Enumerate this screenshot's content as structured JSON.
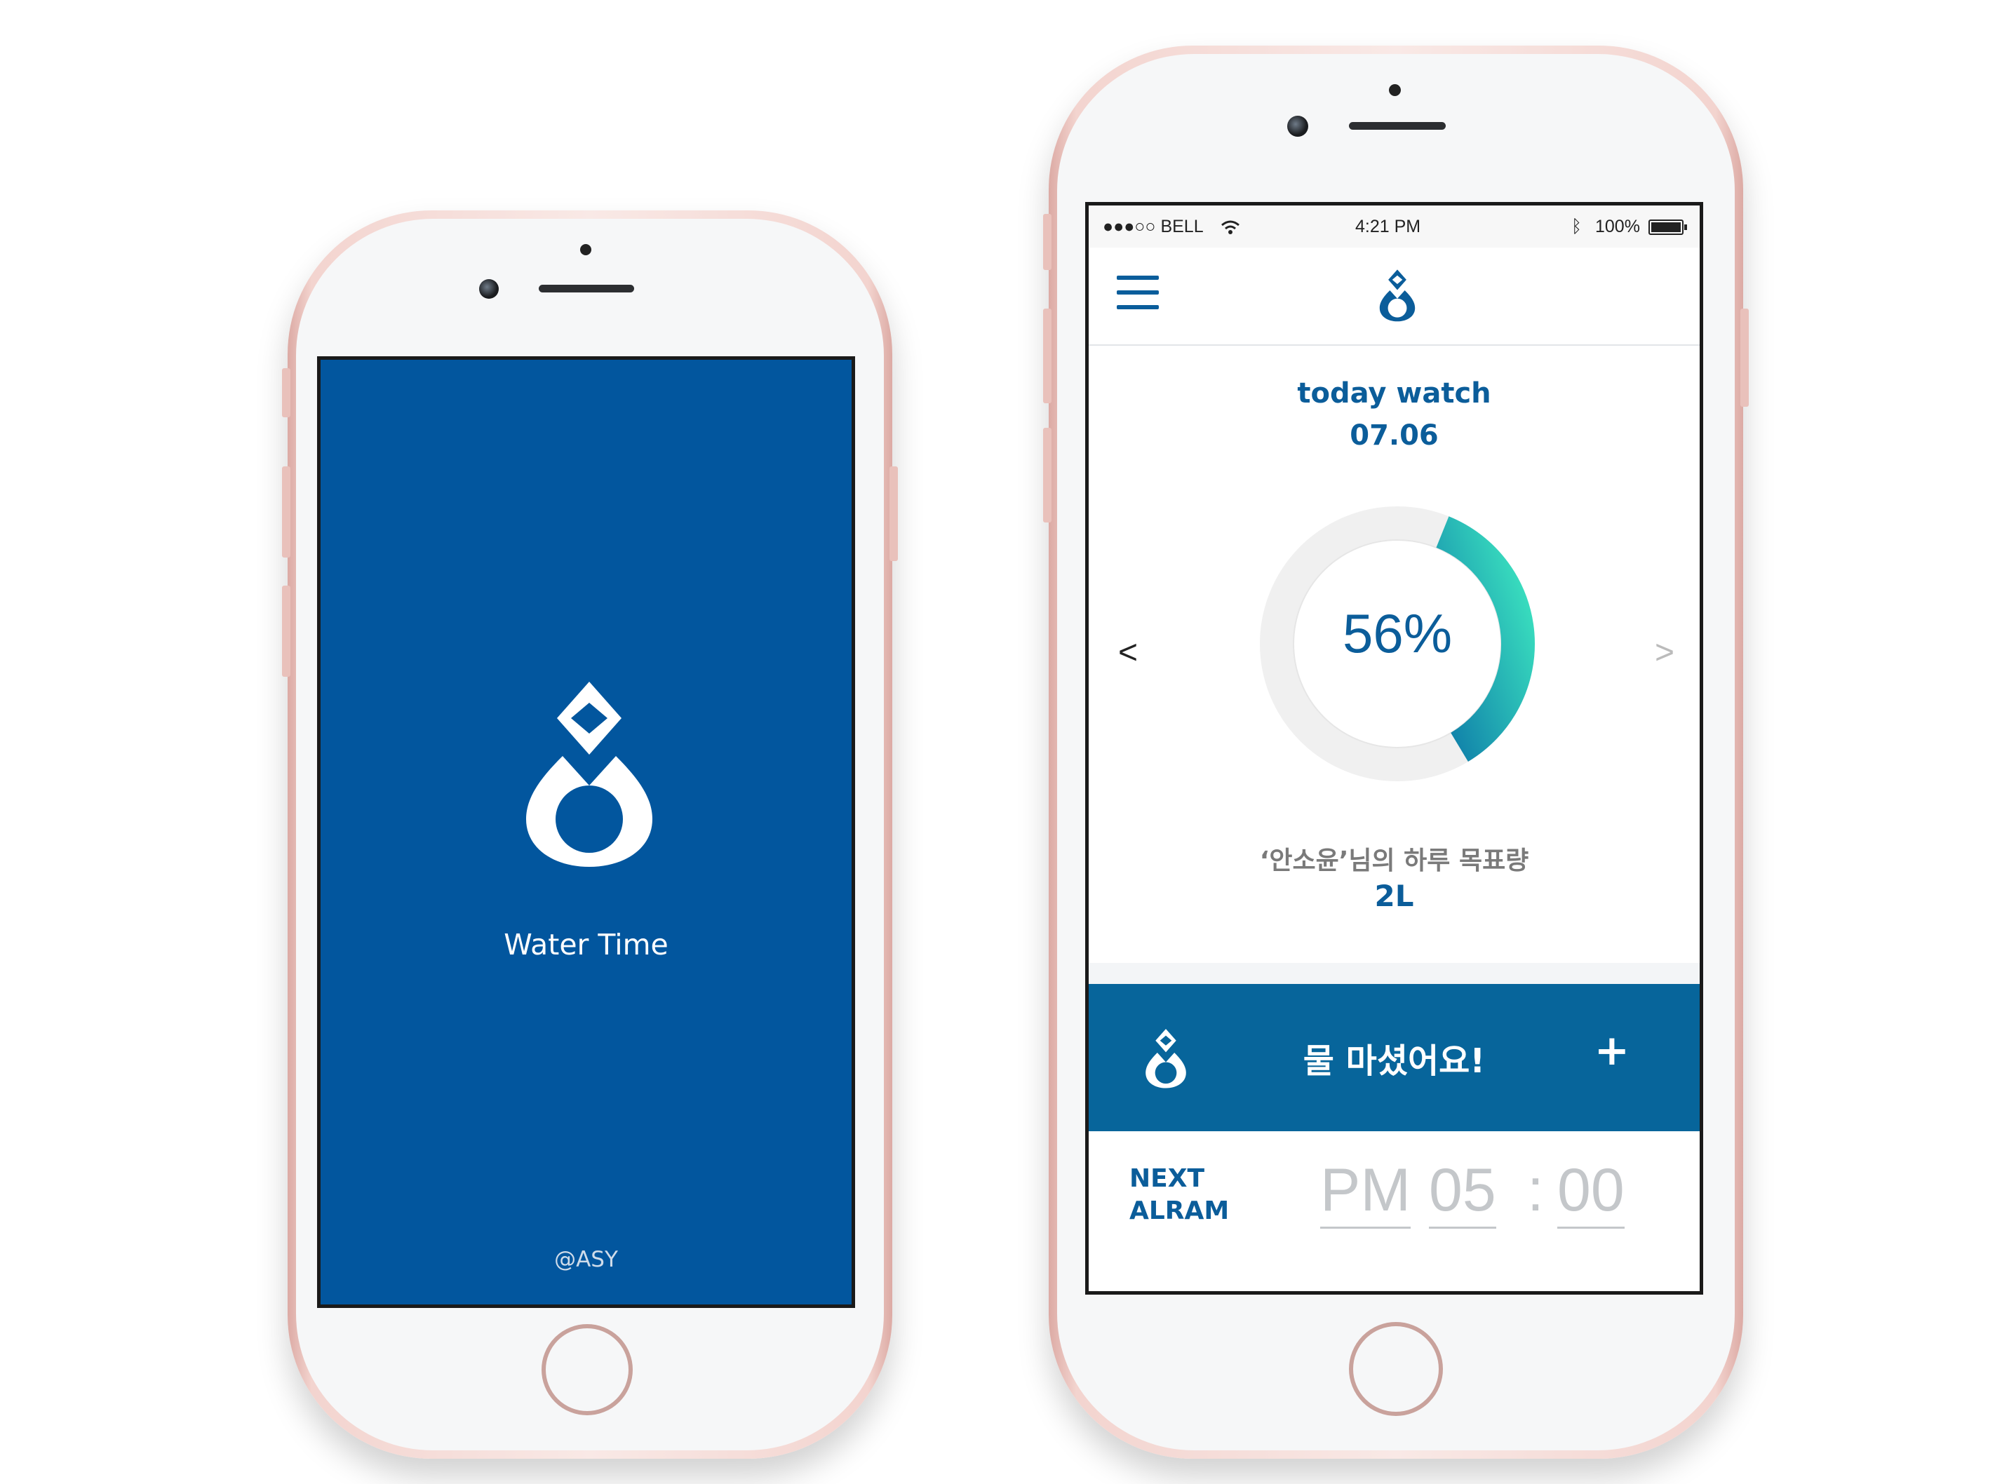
{
  "splash": {
    "app_name": "Water Time",
    "credit": "@ASY",
    "background": "#02569e"
  },
  "app": {
    "status_bar": {
      "carrier": "●●●○○ BELL",
      "time": "4:21 PM",
      "battery": "100%"
    },
    "header": {
      "menu_icon": "hamburger-icon",
      "logo_icon": "water-drop-icon"
    },
    "today": {
      "title": "today watch",
      "date": "07.06"
    },
    "progress": {
      "percent": 56,
      "label": "56%",
      "prev": "<",
      "next": ">"
    },
    "goal": {
      "label": "‘안소윤’님의 하루 목표량",
      "amount": "2L"
    },
    "drink_button": {
      "label": "물 마셨어요!",
      "plus": "+"
    },
    "next_alarm": {
      "line1": "NEXT",
      "line2": "ALRAM",
      "meridiem": "PM",
      "hour": "05",
      "separator": ":",
      "minute": "00"
    },
    "colors": {
      "primary": "#0b5d9a",
      "button": "#07659b",
      "ring_start": "#0d7aa8",
      "ring_end": "#3de6c0"
    }
  }
}
